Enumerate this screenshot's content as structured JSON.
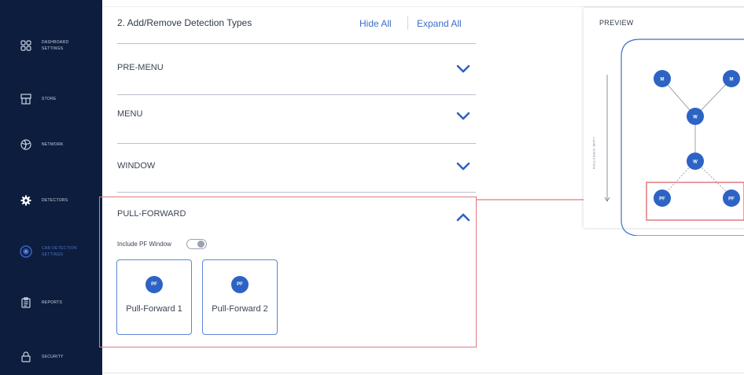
{
  "sidebar": {
    "items": [
      {
        "label": "DASHBOARD SETTINGS",
        "icon": "dashboard-grid-icon"
      },
      {
        "label": "STORE",
        "icon": "store-icon"
      },
      {
        "label": "NETWORK",
        "icon": "network-globe-icon"
      },
      {
        "label": "DETECTORS",
        "icon": "gear-icon"
      },
      {
        "label": "CAR DETECTION SETTINGS",
        "icon": "car-detection-icon",
        "active": true
      },
      {
        "label": "REPORTS",
        "icon": "clipboard-icon"
      },
      {
        "label": "SECURITY",
        "icon": "lock-icon"
      }
    ]
  },
  "detection": {
    "title": "2. Add/Remove Detection Types",
    "hide_all": "Hide All",
    "expand_all": "Expand All",
    "sections": [
      {
        "label": "PRE-MENU",
        "expanded": false
      },
      {
        "label": "MENU",
        "expanded": false
      },
      {
        "label": "WINDOW",
        "expanded": false
      },
      {
        "label": "PULL-FORWARD",
        "expanded": true
      }
    ],
    "pull_forward": {
      "toggle_label": "Include PF Window",
      "toggle_on": false,
      "cards": [
        {
          "badge": "PF",
          "label": "Pull-Forward 1"
        },
        {
          "badge": "PF",
          "label": "Pull-Forward 2"
        }
      ]
    }
  },
  "preview": {
    "title": "PREVIEW",
    "lane_label": "LANE DIRECTION",
    "nodes": [
      "M",
      "M",
      "W",
      "W",
      "PF",
      "PF"
    ]
  },
  "colors": {
    "sidebar_bg": "#0d1d3d",
    "accent": "#2d63c4",
    "highlight": "#e07a7e"
  }
}
